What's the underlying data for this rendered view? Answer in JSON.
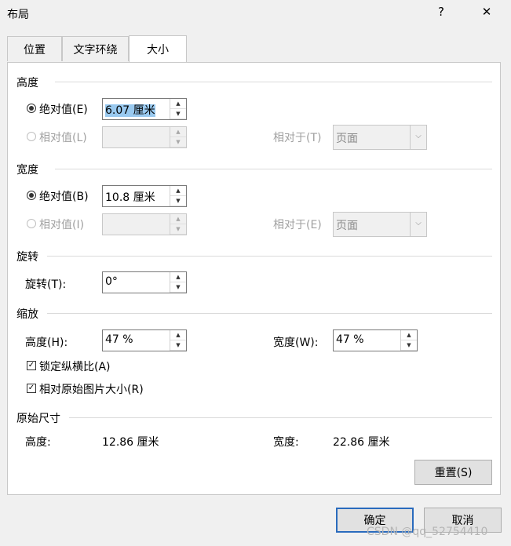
{
  "window": {
    "title": "布局",
    "help_label": "?",
    "close_label": "✕"
  },
  "tabs": [
    {
      "label": "位置",
      "active": false
    },
    {
      "label": "文字环绕",
      "active": false
    },
    {
      "label": "大小",
      "active": true
    }
  ],
  "height": {
    "section": "高度",
    "absolute_label": "绝对值(E)",
    "absolute_value": "6.07 厘米",
    "relative_label": "相对值(L)",
    "relative_value": "",
    "relative_to_label": "相对于(T)",
    "relative_to_value": "页面"
  },
  "width": {
    "section": "宽度",
    "absolute_label": "绝对值(B)",
    "absolute_value": "10.8 厘米",
    "relative_label": "相对值(I)",
    "relative_value": "",
    "relative_to_label": "相对于(E)",
    "relative_to_value": "页面"
  },
  "rotation": {
    "section": "旋转",
    "label": "旋转(T):",
    "value": "0°"
  },
  "scale": {
    "section": "缩放",
    "height_label": "高度(H):",
    "height_value": "47 %",
    "width_label": "宽度(W):",
    "width_value": "47 %",
    "lock_aspect_label": "锁定纵横比(A)",
    "lock_aspect_checked": true,
    "relative_original_label": "相对原始图片大小(R)",
    "relative_original_checked": true
  },
  "original_size": {
    "section": "原始尺寸",
    "height_label": "高度:",
    "height_value": "12.86 厘米",
    "width_label": "宽度:",
    "width_value": "22.86 厘米"
  },
  "buttons": {
    "reset": "重置(S)",
    "ok": "确定",
    "cancel": "取消"
  },
  "watermark": "CSDN @qq_52754410",
  "icons": {
    "check": "✓",
    "spin_up": "▲",
    "spin_down": "▼",
    "dropdown": "⌵"
  }
}
